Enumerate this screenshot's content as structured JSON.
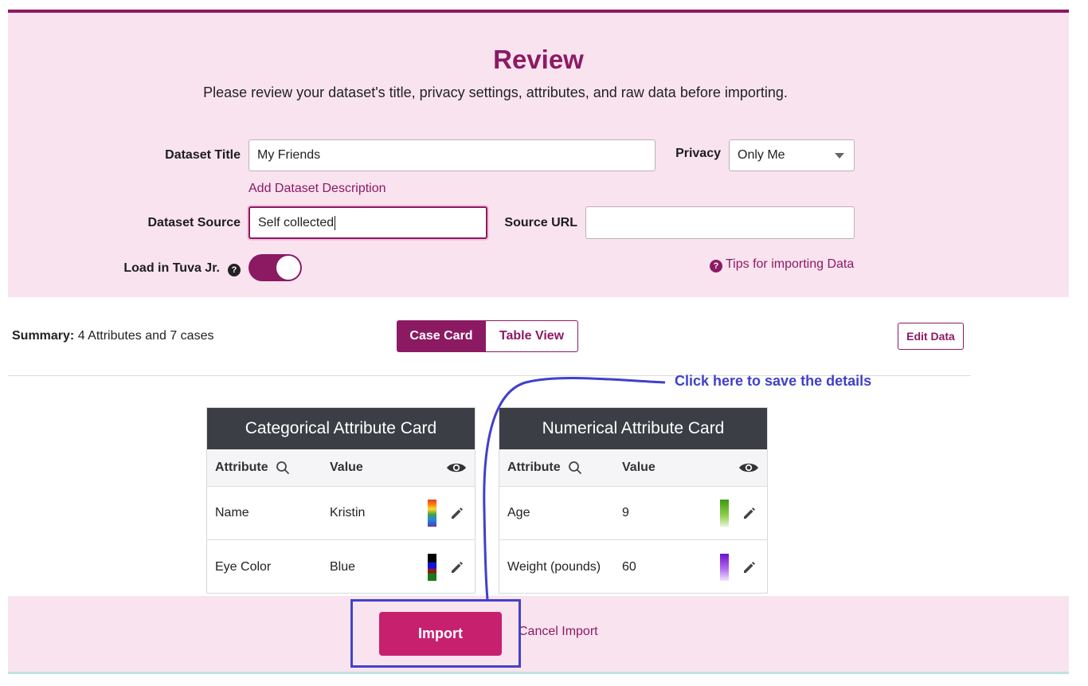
{
  "header": {
    "title": "Review",
    "subtitle": "Please review your dataset's title, privacy settings, attributes, and raw data before importing."
  },
  "form": {
    "dataset_title_label": "Dataset Title",
    "dataset_title_value": "My Friends",
    "privacy_label": "Privacy",
    "privacy_value": "Only Me",
    "add_description_link": "Add Dataset Description",
    "dataset_source_label": "Dataset Source",
    "dataset_source_value": "Self collected",
    "source_url_label": "Source URL",
    "source_url_value": "",
    "load_tuva_label": "Load in Tuva Jr.",
    "load_tuva_on": true,
    "help_glyph": "?",
    "tips_link": "Tips for importing Data"
  },
  "summary": {
    "label": "Summary:",
    "text": "4 Attributes and 7 cases"
  },
  "view_toggle": {
    "case_card": "Case Card",
    "table_view": "Table View",
    "selected": "Case Card"
  },
  "edit_data_label": "Edit Data",
  "cards": [
    {
      "title": "Categorical Attribute Card",
      "col_attribute": "Attribute",
      "col_value": "Value",
      "rows": [
        {
          "attribute": "Name",
          "value": "Kristin",
          "swatch": "rainbow"
        },
        {
          "attribute": "Eye Color",
          "value": "Blue",
          "swatch": "categorical-dark"
        }
      ]
    },
    {
      "title": "Numerical Attribute Card",
      "col_attribute": "Attribute",
      "col_value": "Value",
      "rows": [
        {
          "attribute": "Age",
          "value": "9",
          "swatch": "green-gradient"
        },
        {
          "attribute": "Weight (pounds)",
          "value": "60",
          "swatch": "purple-gradient"
        }
      ]
    }
  ],
  "footer": {
    "import_label": "Import",
    "cancel_label": "Cancel Import"
  },
  "annotation": {
    "text": "Click here to save the details",
    "color": "#4040cc"
  },
  "colors": {
    "brand": "#8c1a63",
    "import": "#c7206e",
    "band": "#f9e3ef"
  }
}
